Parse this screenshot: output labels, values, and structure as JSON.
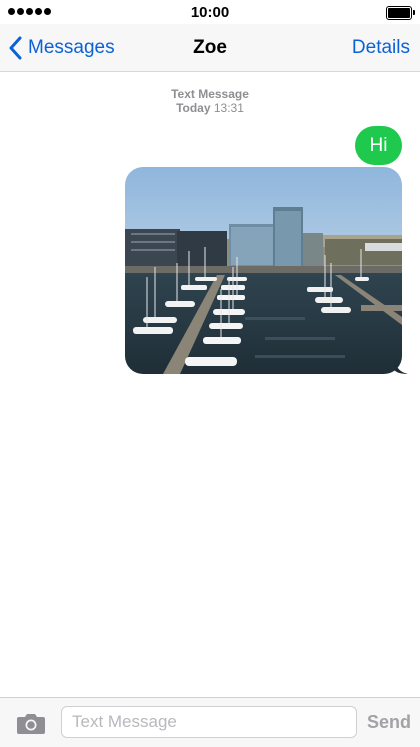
{
  "status_bar": {
    "time": "10:00",
    "signal_dots": 5,
    "battery_level": 1.0
  },
  "nav": {
    "back_label": "Messages",
    "title": "Zoe",
    "details_label": "Details"
  },
  "conversation": {
    "meta_label": "Text Message",
    "meta_day": "Today",
    "meta_time": "13:31",
    "messages": [
      {
        "type": "text",
        "text": "Hi",
        "direction": "outgoing",
        "color": "#1fc94e"
      },
      {
        "type": "image",
        "direction": "outgoing",
        "description_icon": "harbor-photo"
      }
    ]
  },
  "composer": {
    "placeholder": "Text Message",
    "value": "",
    "send_label": "Send"
  },
  "colors": {
    "accent": "#0a62d6",
    "imessage_green": "#1fc94e",
    "muted": "#8e8e93"
  }
}
